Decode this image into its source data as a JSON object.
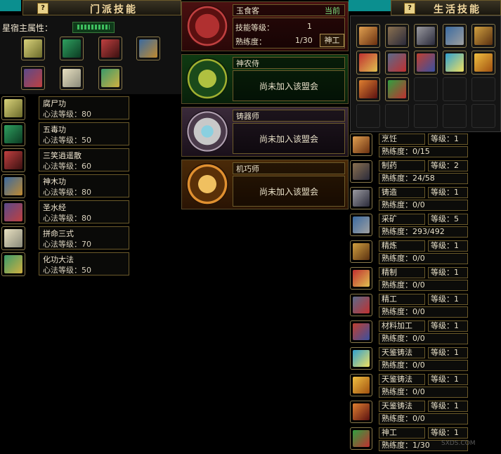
{
  "sect": {
    "title": "门派技能",
    "help": "?",
    "attr_label": "星宿主属性：",
    "skills": [
      {
        "name": "腐尸功",
        "level": "心法等级：80"
      },
      {
        "name": "五毒功",
        "level": "心法等级：50"
      },
      {
        "name": "三笑逍遥散",
        "level": "心法等级：60"
      },
      {
        "name": "神木功",
        "level": "心法等级：80"
      },
      {
        "name": "圣水经",
        "level": "心法等级：80"
      },
      {
        "name": "拼命三式",
        "level": "心法等级：70"
      },
      {
        "name": "化功大法",
        "level": "心法等级：50"
      }
    ]
  },
  "careers": [
    {
      "name": "玉食客",
      "current": "当前",
      "level_label": "技能等级：",
      "level": "1",
      "prof_label": "熟练度：",
      "prof": "1/30",
      "button": "神工"
    },
    {
      "name": "神农侍",
      "status": "尚未加入该盟会"
    },
    {
      "name": "铸器师",
      "status": "尚未加入该盟会"
    },
    {
      "name": "机巧师",
      "status": "尚未加入该盟会"
    }
  ],
  "life": {
    "title": "生活技能",
    "help": "?",
    "skills": [
      {
        "name": "烹饪",
        "level": "等级：1",
        "prof": "熟练度：0/15"
      },
      {
        "name": "制药",
        "level": "等级：2",
        "prof": "熟练度：24/58"
      },
      {
        "name": "铸造",
        "level": "等级：1",
        "prof": "熟练度：0/0"
      },
      {
        "name": "采矿",
        "level": "等级：5",
        "prof": "熟练度：293/492"
      },
      {
        "name": "精炼",
        "level": "等级：1",
        "prof": "熟练度：0/0"
      },
      {
        "name": "精制",
        "level": "等级：1",
        "prof": "熟练度：0/0"
      },
      {
        "name": "精工",
        "level": "等级：1",
        "prof": "熟练度：0/0"
      },
      {
        "name": "材料加工",
        "level": "等级：1",
        "prof": "熟练度：0/0"
      },
      {
        "name": "天鉴铸法",
        "level": "等级：1",
        "prof": "熟练度：0/0"
      },
      {
        "name": "天鉴铸法",
        "level": "等级：1",
        "prof": "熟练度：0/0"
      },
      {
        "name": "天鉴铸法",
        "level": "等级：1",
        "prof": "熟练度：0/0"
      },
      {
        "name": "神工",
        "level": "等级：1",
        "prof": "熟练度：1/30"
      }
    ]
  },
  "watermark": "SXDS.COM",
  "colors": {
    "gold_border": "#6b5a2a",
    "teal": "#0b8f8f",
    "title": "#f3d9a0"
  }
}
